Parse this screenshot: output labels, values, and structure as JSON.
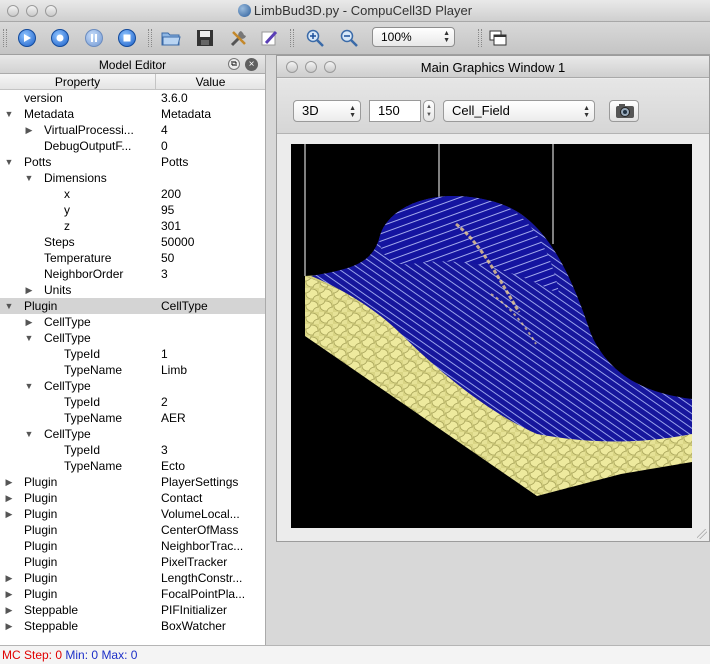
{
  "window": {
    "title": "LimbBud3D.py - CompuCell3D Player"
  },
  "toolbar": {
    "zoom_value": "100%"
  },
  "model_editor": {
    "title": "Model Editor",
    "col_property": "Property",
    "col_value": "Value",
    "rows": [
      {
        "prop": "version",
        "val": "3.6.0",
        "level": 0,
        "arrow": ""
      },
      {
        "prop": "Metadata",
        "val": "Metadata",
        "level": 0,
        "arrow": "down"
      },
      {
        "prop": "VirtualProcessi...",
        "val": "4",
        "level": 1,
        "arrow": "right"
      },
      {
        "prop": "DebugOutputF...",
        "val": "0",
        "level": 1,
        "arrow": ""
      },
      {
        "prop": "Potts",
        "val": "Potts",
        "level": 0,
        "arrow": "down"
      },
      {
        "prop": "Dimensions",
        "val": "",
        "level": 1,
        "arrow": "down"
      },
      {
        "prop": "x",
        "val": "200",
        "level": 2,
        "arrow": ""
      },
      {
        "prop": "y",
        "val": "95",
        "level": 2,
        "arrow": ""
      },
      {
        "prop": "z",
        "val": "301",
        "level": 2,
        "arrow": ""
      },
      {
        "prop": "Steps",
        "val": "50000",
        "level": 1,
        "arrow": ""
      },
      {
        "prop": "Temperature",
        "val": "50",
        "level": 1,
        "arrow": ""
      },
      {
        "prop": "NeighborOrder",
        "val": "3",
        "level": 1,
        "arrow": ""
      },
      {
        "prop": "Units",
        "val": "",
        "level": 1,
        "arrow": "right"
      },
      {
        "prop": "Plugin",
        "val": "CellType",
        "level": 0,
        "arrow": "down",
        "selected": true
      },
      {
        "prop": "CellType",
        "val": "",
        "level": 1,
        "arrow": "right"
      },
      {
        "prop": "CellType",
        "val": "",
        "level": 1,
        "arrow": "down"
      },
      {
        "prop": "TypeId",
        "val": "1",
        "level": 2,
        "arrow": ""
      },
      {
        "prop": "TypeName",
        "val": "Limb",
        "level": 2,
        "arrow": ""
      },
      {
        "prop": "CellType",
        "val": "",
        "level": 1,
        "arrow": "down"
      },
      {
        "prop": "TypeId",
        "val": "2",
        "level": 2,
        "arrow": ""
      },
      {
        "prop": "TypeName",
        "val": "AER",
        "level": 2,
        "arrow": ""
      },
      {
        "prop": "CellType",
        "val": "",
        "level": 1,
        "arrow": "down"
      },
      {
        "prop": "TypeId",
        "val": "3",
        "level": 2,
        "arrow": ""
      },
      {
        "prop": "TypeName",
        "val": "Ecto",
        "level": 2,
        "arrow": ""
      },
      {
        "prop": "Plugin",
        "val": "PlayerSettings",
        "level": 0,
        "arrow": "right"
      },
      {
        "prop": "Plugin",
        "val": "Contact",
        "level": 0,
        "arrow": "right"
      },
      {
        "prop": "Plugin",
        "val": "VolumeLocal...",
        "level": 0,
        "arrow": "right"
      },
      {
        "prop": "Plugin",
        "val": "CenterOfMass",
        "level": 0,
        "arrow": ""
      },
      {
        "prop": "Plugin",
        "val": "NeighborTrac...",
        "level": 0,
        "arrow": ""
      },
      {
        "prop": "Plugin",
        "val": "PixelTracker",
        "level": 0,
        "arrow": ""
      },
      {
        "prop": "Plugin",
        "val": "LengthConstr...",
        "level": 0,
        "arrow": "right"
      },
      {
        "prop": "Plugin",
        "val": "FocalPointPla...",
        "level": 0,
        "arrow": "right"
      },
      {
        "prop": "Steppable",
        "val": "PIFInitializer",
        "level": 0,
        "arrow": "right"
      },
      {
        "prop": "Steppable",
        "val": "BoxWatcher",
        "level": 0,
        "arrow": "right"
      }
    ]
  },
  "graphics": {
    "title": "Main Graphics Window 1",
    "view_mode": "3D",
    "slice_value": "150",
    "field": "Cell_Field"
  },
  "status": {
    "mc_step_label": "MC Step:",
    "mc_step_value": "0",
    "min_label": "Min:",
    "min_value": "0",
    "max_label": "Max:",
    "max_value": "0"
  },
  "colors": {
    "limb": "#1a1aa8",
    "ecto": "#e8e49a",
    "aer": "#f0d090",
    "background": "#000000"
  }
}
